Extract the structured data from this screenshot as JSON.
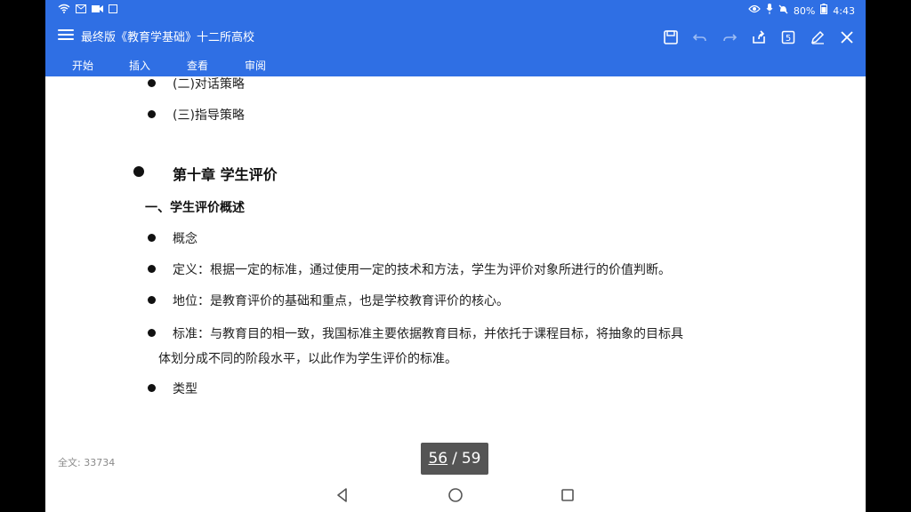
{
  "status_bar": {
    "battery": "80%",
    "time": "4:43"
  },
  "app_bar": {
    "title": "最终版《教育学基础》十二所高校",
    "actions": [
      "save-icon",
      "undo-icon",
      "redo-icon",
      "share-icon",
      "page-view-icon",
      "edit-icon",
      "close-icon"
    ]
  },
  "tabs": [
    "开始",
    "插入",
    "查看",
    "审阅"
  ],
  "document": {
    "lines": [
      "(二)对话策略",
      "(三)指导策略",
      "第十章  学生评价",
      "一、学生评价概述",
      "概念",
      "定义：根据一定的标准，通过使用一定的技术和方法，学生为评价对象所进行的价值判断。",
      "地位：是教育评价的基础和重点，也是学校教育评价的核心。",
      "标准：与教育目的相一致，我国标准主要依据教育目标，并依托于课程目标，将抽象的目标具",
      "体划分成不同的阶段水平，以此作为学生评价的标准。",
      "类型"
    ]
  },
  "word_count": "全文: 33734",
  "pager": {
    "current": "56",
    "separator": "/",
    "total": "59"
  },
  "colors": {
    "accent": "#2f6fe4",
    "pager_bg": "#555555"
  }
}
